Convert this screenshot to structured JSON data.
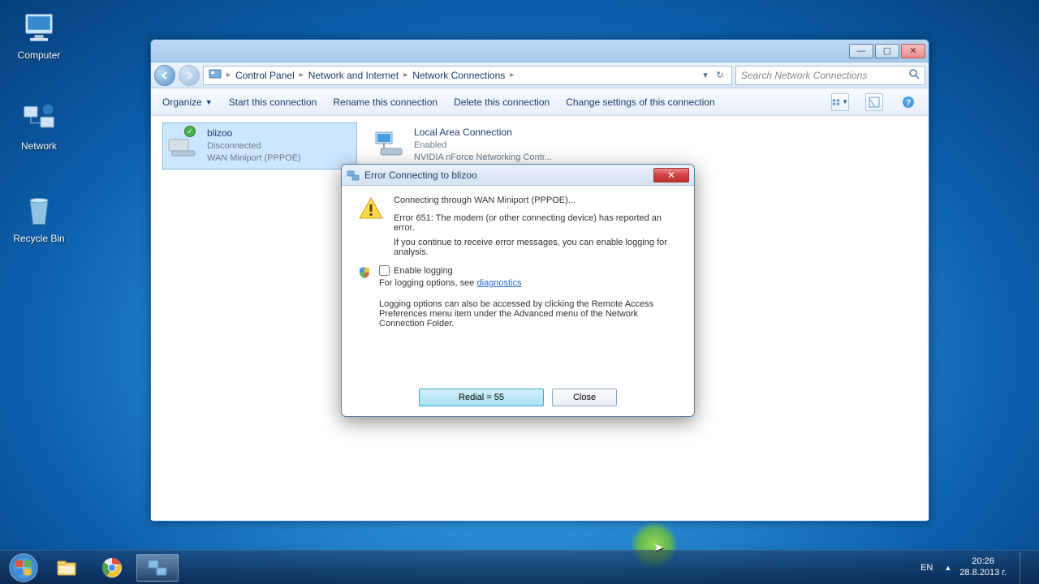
{
  "desktop": {
    "icons": [
      {
        "label": "Computer"
      },
      {
        "label": "Network"
      },
      {
        "label": "Recycle Bin"
      }
    ]
  },
  "explorer": {
    "breadcrumbs": [
      "Control Panel",
      "Network and Internet",
      "Network Connections"
    ],
    "searchPlaceholder": "Search Network Connections",
    "toolbar": {
      "organize": "Organize",
      "start": "Start this connection",
      "rename": "Rename this connection",
      "delete": "Delete this connection",
      "change": "Change settings of this connection"
    },
    "connections": [
      {
        "name": "blizoo",
        "status": "Disconnected",
        "device": "WAN Miniport (PPPOE)"
      },
      {
        "name": "Local Area Connection",
        "status": "Enabled",
        "device": "NVIDIA nForce Networking Contr..."
      }
    ]
  },
  "dialog": {
    "title": "Error Connecting to blizoo",
    "line1": "Connecting through WAN Miniport (PPPOE)...",
    "error": "Error 651: The modem (or other connecting device) has reported an error.",
    "hint": "If you continue to receive error messages, you can enable logging for analysis.",
    "enableLogging": "Enable logging",
    "loggingPrefix": "For logging options, see ",
    "diagnosticsLink": "diagnostics",
    "loggingNote": "Logging options can also be accessed by clicking the Remote Access Preferences menu item under the Advanced menu of the Network Connection Folder.",
    "redial": "Redial = 55",
    "close": "Close"
  },
  "taskbar": {
    "lang": "EN",
    "time": "20:26",
    "date": "28.8.2013 г."
  }
}
